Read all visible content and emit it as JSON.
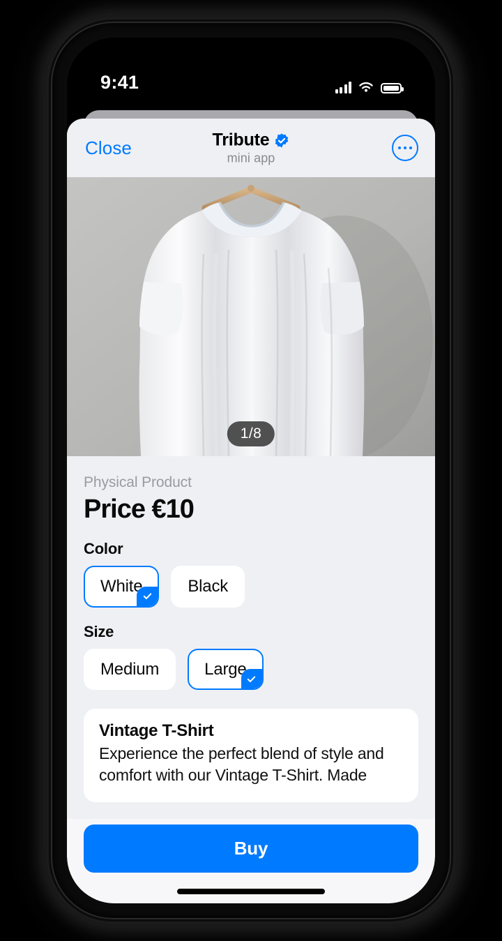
{
  "status_bar": {
    "time": "9:41",
    "cellular_icon": "signal-bars-icon",
    "wifi_icon": "wifi-icon",
    "battery_icon": "battery-full-icon"
  },
  "app_bar": {
    "close_label": "Close",
    "app_name": "Tribute",
    "verified_icon": "verified-badge-icon",
    "subtitle": "mini app",
    "more_icon": "more-options-icon"
  },
  "gallery": {
    "counter": "1/8",
    "image_description": "white t-shirt on wooden hanger against grey wall"
  },
  "product": {
    "kicker": "Physical Product",
    "price": "Price €10",
    "color_label": "Color",
    "color_options": [
      {
        "label": "White",
        "selected": true
      },
      {
        "label": "Black",
        "selected": false
      }
    ],
    "size_label": "Size",
    "size_options": [
      {
        "label": "Medium",
        "selected": false
      },
      {
        "label": "Large",
        "selected": true
      }
    ]
  },
  "description": {
    "title": "Vintage T-Shirt",
    "body": "Experience the perfect blend of style and comfort with our Vintage T-Shirt. Made"
  },
  "footer": {
    "buy_label": "Buy"
  },
  "colors": {
    "accent": "#007AFF",
    "sheet_background": "#EFF0F4",
    "card_background": "#FFFFFF",
    "bottom_bar": "#F7F7F9",
    "muted_text": "#9A9AA0",
    "counter_pill": "#3A3A3A"
  }
}
